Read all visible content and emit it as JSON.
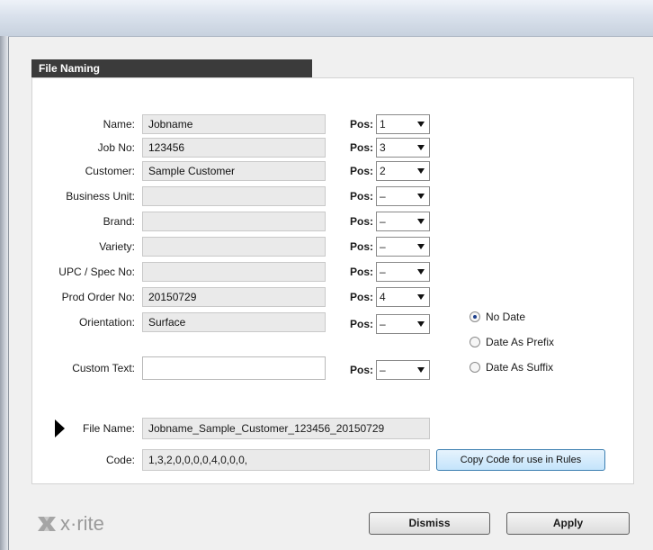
{
  "section": {
    "title": "File Naming"
  },
  "rows": [
    {
      "label": "Name:",
      "value": "Jobname",
      "pos_label": "Pos:",
      "pos": "1"
    },
    {
      "label": "Job No:",
      "value": "123456",
      "pos_label": "Pos:",
      "pos": "3"
    },
    {
      "label": "Customer:",
      "value": "Sample Customer",
      "pos_label": "Pos:",
      "pos": "2"
    },
    {
      "label": "Business Unit:",
      "value": "",
      "pos_label": "Pos:",
      "pos": "–"
    },
    {
      "label": "Brand:",
      "value": "",
      "pos_label": "Pos:",
      "pos": "–"
    },
    {
      "label": "Variety:",
      "value": "",
      "pos_label": "Pos:",
      "pos": "–"
    },
    {
      "label": "UPC / Spec No:",
      "value": "",
      "pos_label": "Pos:",
      "pos": "–"
    },
    {
      "label": "Prod Order No:",
      "value": "20150729",
      "pos_label": "Pos:",
      "pos": "4"
    },
    {
      "label": "Orientation:",
      "value": "Surface",
      "pos_label": "Pos:",
      "pos": "–"
    }
  ],
  "custom_text": {
    "label": "Custom Text:",
    "value": "",
    "pos_label": "Pos:",
    "pos": "–"
  },
  "date_options": {
    "selected": "No Date",
    "items": [
      "No Date",
      "Date As Prefix",
      "Date As Suffix"
    ]
  },
  "file_name": {
    "label": "File Name:",
    "value": "Jobname_Sample_Customer_123456_20150729"
  },
  "code": {
    "label": "Code:",
    "value": "1,3,2,0,0,0,0,4,0,0,0,"
  },
  "buttons": {
    "copy_code": "Copy Code for use in Rules",
    "dismiss": "Dismiss",
    "apply": "Apply"
  },
  "logo": {
    "text": "x·rite"
  }
}
